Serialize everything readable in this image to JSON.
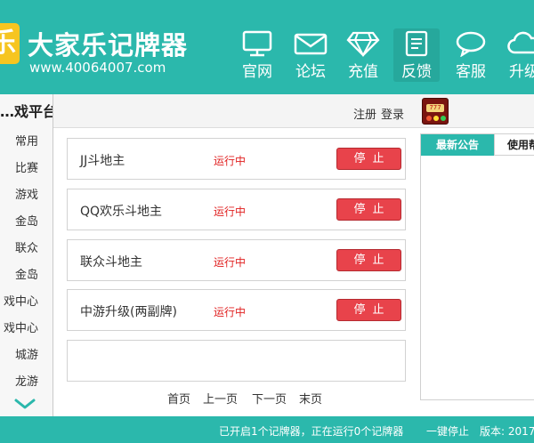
{
  "header": {
    "logo_glyph": "乐",
    "app_name": "大家乐记牌器",
    "app_url": "www.40064007.com",
    "nav": [
      {
        "label": "官网",
        "icon": "monitor-icon"
      },
      {
        "label": "论坛",
        "icon": "envelope-icon"
      },
      {
        "label": "充值",
        "icon": "diamond-icon"
      },
      {
        "label": "反馈",
        "icon": "document-icon"
      },
      {
        "label": "客服",
        "icon": "chat-bubble-icon"
      },
      {
        "label": "升级",
        "icon": "cloud-icon"
      }
    ]
  },
  "sidebar": {
    "title": "…戏平台",
    "items": [
      "常用",
      "比赛",
      "游戏",
      "金岛",
      "联众",
      "金岛",
      "戏中心",
      "戏中心",
      "城游",
      "龙游"
    ],
    "scroll_icon": "chevron-down-icon"
  },
  "topbar": {
    "register": "注册",
    "login": "登录",
    "slot_label": "777"
  },
  "games": [
    {
      "name": "JJ斗地主",
      "status": "运行中",
      "button": "停止"
    },
    {
      "name": "QQ欢乐斗地主",
      "status": "运行中",
      "button": "停止"
    },
    {
      "name": "联众斗地主",
      "status": "运行中",
      "button": "停止"
    },
    {
      "name": "中游升级(两副牌)",
      "status": "运行中",
      "button": "停止"
    }
  ],
  "pager": {
    "first": "首页",
    "prev": "上一页",
    "next": "下一页",
    "last": "末页"
  },
  "notice": {
    "tab_latest": "最新公告",
    "tab_guide": "使用帮助"
  },
  "statusbar": {
    "text": "已开启1个记牌器，正在运行0个记牌器",
    "stop_all": "一键停止",
    "version": "版本: 2017"
  },
  "colors": {
    "accent": "#2bb8ac",
    "stop_button": "#e8434b",
    "running_text": "#e02020"
  }
}
